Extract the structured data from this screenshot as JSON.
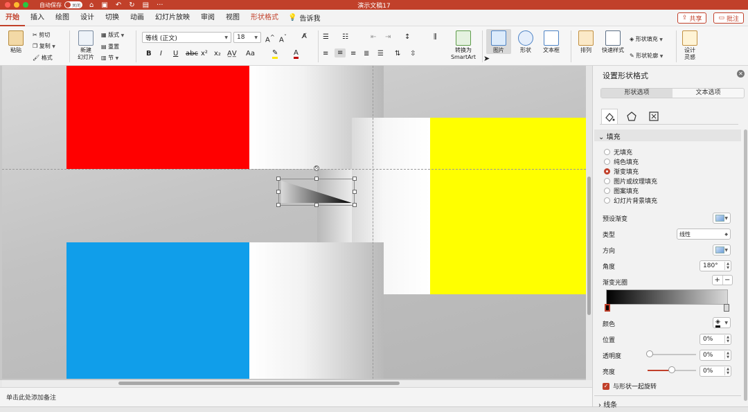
{
  "titlebar": {
    "autosave_label": "自动保存",
    "autosave_state": "关闭",
    "doc_title": "演示文稿17"
  },
  "tabs": [
    {
      "label": "开始",
      "active": true
    },
    {
      "label": "插入"
    },
    {
      "label": "绘图"
    },
    {
      "label": "设计"
    },
    {
      "label": "切换"
    },
    {
      "label": "动画"
    },
    {
      "label": "幻灯片放映"
    },
    {
      "label": "审阅"
    },
    {
      "label": "视图"
    },
    {
      "label": "形状格式"
    }
  ],
  "tellme": "告诉我",
  "header_buttons": {
    "share": "共享",
    "comment": "批注"
  },
  "ribbon": {
    "paste": "粘贴",
    "cut": "剪切",
    "copy": "复制",
    "format": "格式",
    "new_slide": [
      "新建",
      "幻灯片"
    ],
    "layout": "版式",
    "reset": "重置",
    "section": "节",
    "font_name": "等线 (正文)",
    "font_size": "18",
    "convert": [
      "转换为",
      "SmartArt"
    ],
    "picture": "图片",
    "shape": "形状",
    "textbox": "文本框",
    "arrange": "排列",
    "quick_styles": "快速样式",
    "shape_fill": "形状填充",
    "shape_outline": "形状轮廓",
    "design_ideas": [
      "设计",
      "灵感"
    ]
  },
  "notes_placeholder": "单击此处添加备注",
  "panel": {
    "title": "设置形状格式",
    "tab_shape": "形状选项",
    "tab_text": "文本选项",
    "fill_section": "填充",
    "fill_options": [
      "无填充",
      "纯色填充",
      "渐变填充",
      "图片或纹理填充",
      "图案填充",
      "幻灯片背景填充"
    ],
    "selected_fill": "渐变填充",
    "preset": "预设渐变",
    "type_label": "类型",
    "type_value": "线性",
    "direction": "方向",
    "angle_label": "角度",
    "angle_value": "180°",
    "stops_label": "渐变光圈",
    "color_label": "颜色",
    "position_label": "位置",
    "position_value": "0%",
    "transparency_label": "透明度",
    "transparency_value": "0%",
    "brightness_label": "亮度",
    "brightness_value": "0%",
    "rotate_with_shape": "与形状一起旋转",
    "line_section": "线条"
  },
  "colors": {
    "accent": "#c1402a",
    "red_block": "#ff0000",
    "yellow_block": "#ffff00",
    "blue_block": "#109eea"
  }
}
